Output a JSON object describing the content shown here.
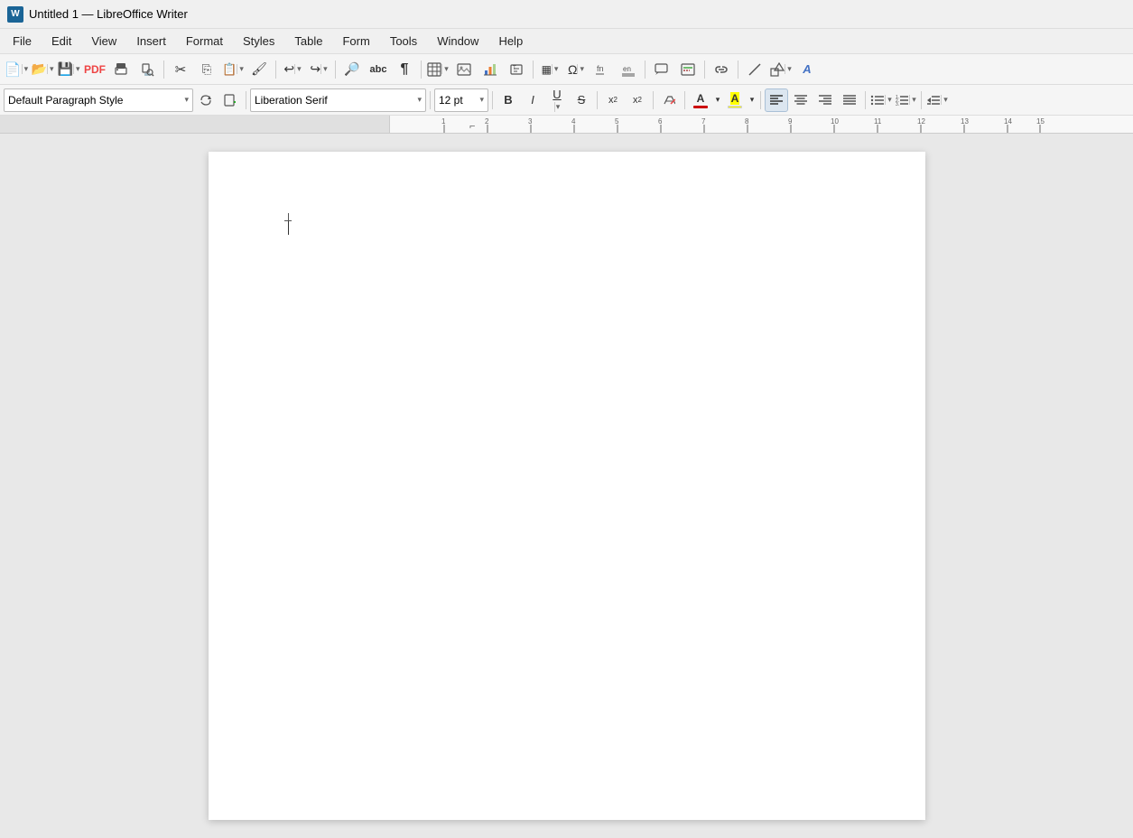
{
  "titlebar": {
    "app_title": "Untitled 1 — LibreOffice Writer",
    "app_icon_text": "W"
  },
  "menubar": {
    "items": [
      {
        "id": "file",
        "label": "File"
      },
      {
        "id": "edit",
        "label": "Edit"
      },
      {
        "id": "view",
        "label": "View"
      },
      {
        "id": "insert",
        "label": "Insert"
      },
      {
        "id": "format",
        "label": "Format"
      },
      {
        "id": "styles",
        "label": "Styles"
      },
      {
        "id": "table",
        "label": "Table"
      },
      {
        "id": "form",
        "label": "Form"
      },
      {
        "id": "tools",
        "label": "Tools"
      },
      {
        "id": "window",
        "label": "Window"
      },
      {
        "id": "help",
        "label": "Help"
      }
    ]
  },
  "toolbar1": {
    "buttons": [
      {
        "id": "new",
        "icon": "📄",
        "title": "New"
      },
      {
        "id": "open",
        "icon": "📂",
        "title": "Open"
      },
      {
        "id": "save",
        "icon": "💾",
        "title": "Save"
      },
      {
        "id": "export-pdf",
        "icon": "📋",
        "title": "Export as PDF"
      },
      {
        "id": "print",
        "icon": "🖨",
        "title": "Print"
      },
      {
        "id": "print-preview",
        "icon": "🔍",
        "title": "Print Preview"
      },
      {
        "id": "cut",
        "icon": "✂",
        "title": "Cut"
      },
      {
        "id": "copy",
        "icon": "⎘",
        "title": "Copy"
      },
      {
        "id": "paste",
        "icon": "📋",
        "title": "Paste"
      },
      {
        "id": "format-paintbrush",
        "icon": "🖌",
        "title": "Format Paintbrush"
      },
      {
        "id": "undo",
        "icon": "↩",
        "title": "Undo"
      },
      {
        "id": "redo",
        "icon": "↪",
        "title": "Redo"
      },
      {
        "id": "find",
        "icon": "🔎",
        "title": "Find & Replace"
      },
      {
        "id": "spellcheck",
        "icon": "abc",
        "title": "Spellcheck"
      },
      {
        "id": "formatting-marks",
        "icon": "¶",
        "title": "Formatting Marks"
      },
      {
        "id": "insert-table",
        "icon": "⊞",
        "title": "Insert Table"
      },
      {
        "id": "insert-image",
        "icon": "🖼",
        "title": "Insert Image"
      },
      {
        "id": "insert-chart",
        "icon": "📊",
        "title": "Insert Chart"
      },
      {
        "id": "insert-textbox",
        "icon": "T",
        "title": "Insert Text Box"
      },
      {
        "id": "insert-field",
        "icon": "▦",
        "title": "Insert Field"
      },
      {
        "id": "insert-special",
        "icon": "Ω",
        "title": "Insert Special Character"
      },
      {
        "id": "insert-footnote",
        "icon": "fn",
        "title": "Insert Footnote"
      },
      {
        "id": "insert-endnote",
        "icon": "en",
        "title": "Insert Endnote"
      },
      {
        "id": "insert-comment",
        "icon": "💬",
        "title": "Insert Comment"
      },
      {
        "id": "manage-changes",
        "icon": "📝",
        "title": "Manage Changes"
      },
      {
        "id": "hyperlink",
        "icon": "🔗",
        "title": "Hyperlink"
      },
      {
        "id": "line",
        "icon": "╱",
        "title": "Line"
      },
      {
        "id": "shapes",
        "icon": "◇",
        "title": "Shapes"
      },
      {
        "id": "fontwork",
        "icon": "A",
        "title": "Fontwork"
      }
    ]
  },
  "toolbar2": {
    "paragraph_style": "Default Paragraph Style",
    "font_name": "Liberation Serif",
    "font_size": "12 pt",
    "bold_label": "B",
    "italic_label": "I",
    "underline_label": "U",
    "strikethrough_label": "S",
    "superscript_label": "x²",
    "subscript_label": "x₂",
    "clear_format_label": "⊘",
    "font_color_label": "A",
    "font_color_hex": "#cc0000",
    "highlight_label": "A",
    "highlight_color_hex": "#ffff00",
    "align_left_label": "≡",
    "align_center_label": "≡",
    "align_right_label": "≡",
    "align_justify_label": "≡",
    "list_unordered_label": "☰",
    "list_ordered_label": "☰",
    "indent_label": "⇥"
  },
  "ruler": {
    "page_number": "1"
  },
  "document": {
    "title": "Untitled 1",
    "content": ""
  }
}
